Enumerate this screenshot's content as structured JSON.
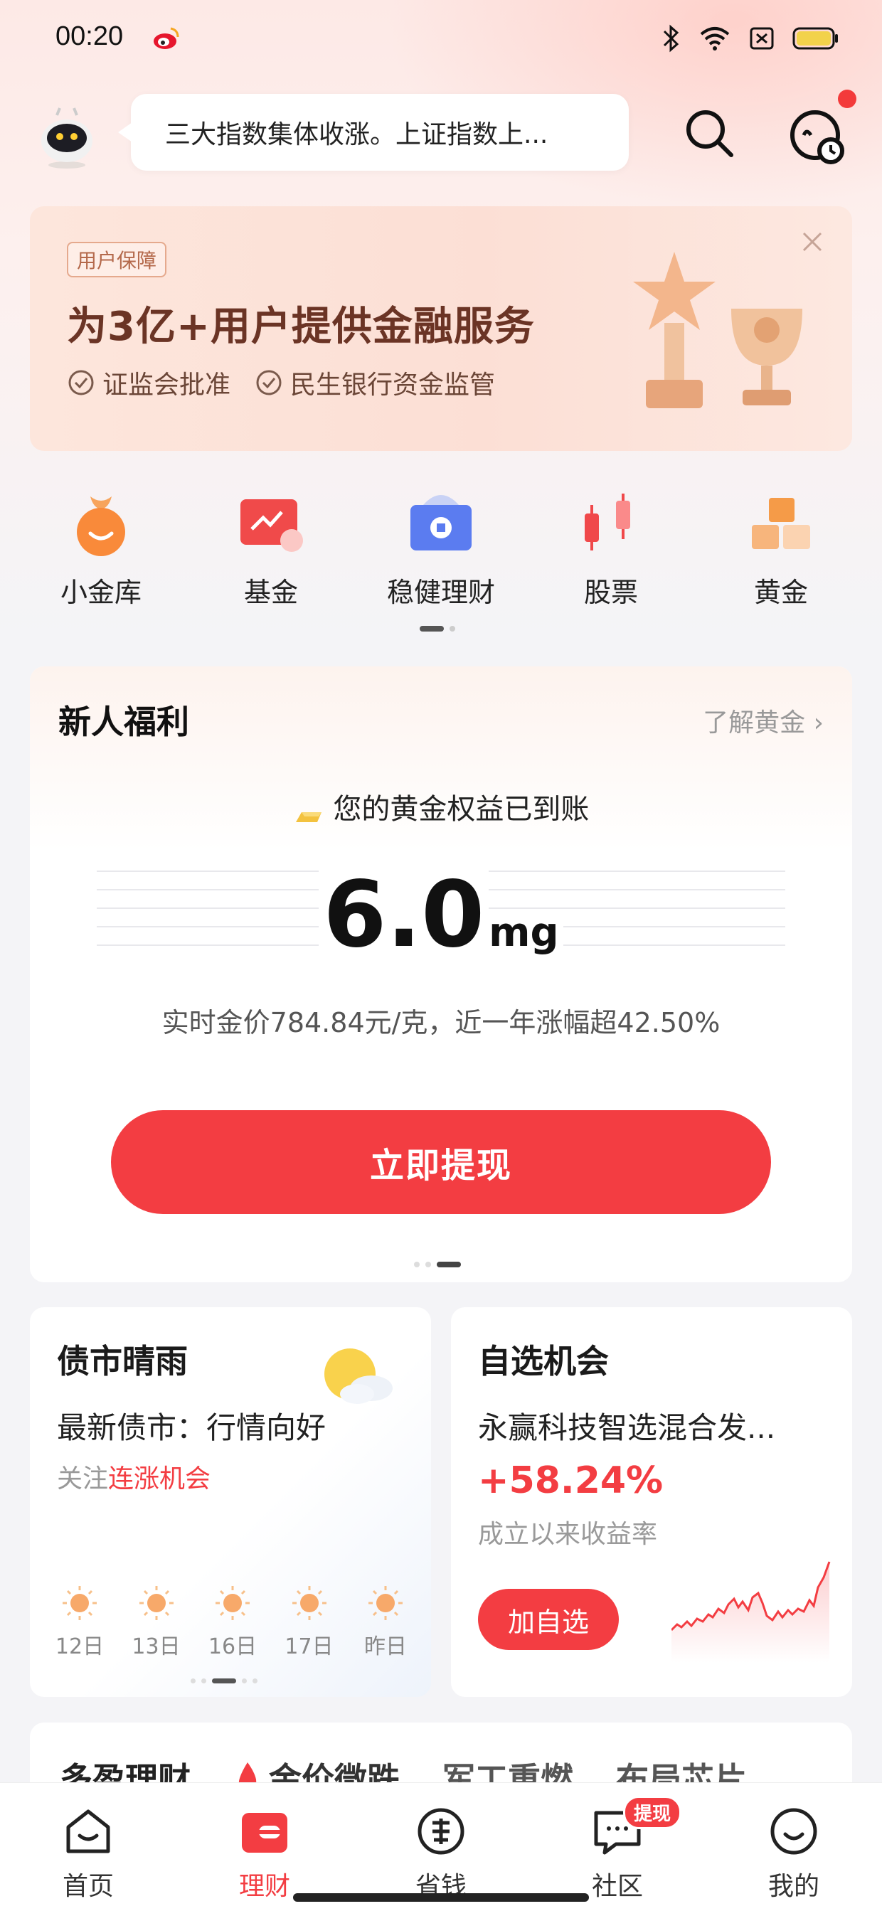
{
  "status_bar": {
    "time": "00:20"
  },
  "header": {
    "ticker": "三大指数集体收涨。上证指数上..."
  },
  "banner": {
    "tag": "用户保障",
    "title": "为3亿+用户提供金融服务",
    "badges": [
      "证监会批准",
      "民生银行资金监管"
    ]
  },
  "quick": [
    {
      "label": "小金库",
      "icon": "piggy-bag-icon"
    },
    {
      "label": "基金",
      "icon": "fund-chart-icon"
    },
    {
      "label": "稳健理财",
      "icon": "shield-wallet-icon"
    },
    {
      "label": "股票",
      "icon": "candlestick-icon"
    },
    {
      "label": "黄金",
      "icon": "gold-bars-icon"
    }
  ],
  "new_user": {
    "title": "新人福利",
    "more": "了解黄金",
    "subtitle": "您的黄金权益已到账",
    "amount": "6.0",
    "unit": "mg",
    "price_text": "实时金价784.84元/克，近一年涨幅超42.50%",
    "button": "立即提现"
  },
  "bond": {
    "title": "债市晴雨",
    "line1": "最新债市：行情向好",
    "line2_prefix": "关注",
    "line2_highlight": "连涨机会",
    "days": [
      "12日",
      "13日",
      "16日",
      "17日",
      "昨日"
    ]
  },
  "pick": {
    "title": "自选机会",
    "fund": "永赢科技智选混合发...",
    "rate": "+58.24%",
    "rate_label": "成立以来收益率",
    "button": "加自选"
  },
  "peek": {
    "items": [
      "多盈理财",
      "金价微跌",
      "军工重燃",
      "布局芯片"
    ]
  },
  "tabbar": {
    "tabs": [
      {
        "label": "首页",
        "icon": "home-icon"
      },
      {
        "label": "理财",
        "icon": "wallet-icon"
      },
      {
        "label": "省钱",
        "icon": "coupon-icon"
      },
      {
        "label": "社区",
        "icon": "chat-icon"
      },
      {
        "label": "我的",
        "icon": "profile-icon"
      }
    ],
    "badge": "提现",
    "active": "理财"
  },
  "colors": {
    "accent": "#f33d42",
    "banner_title": "#6b3425"
  }
}
